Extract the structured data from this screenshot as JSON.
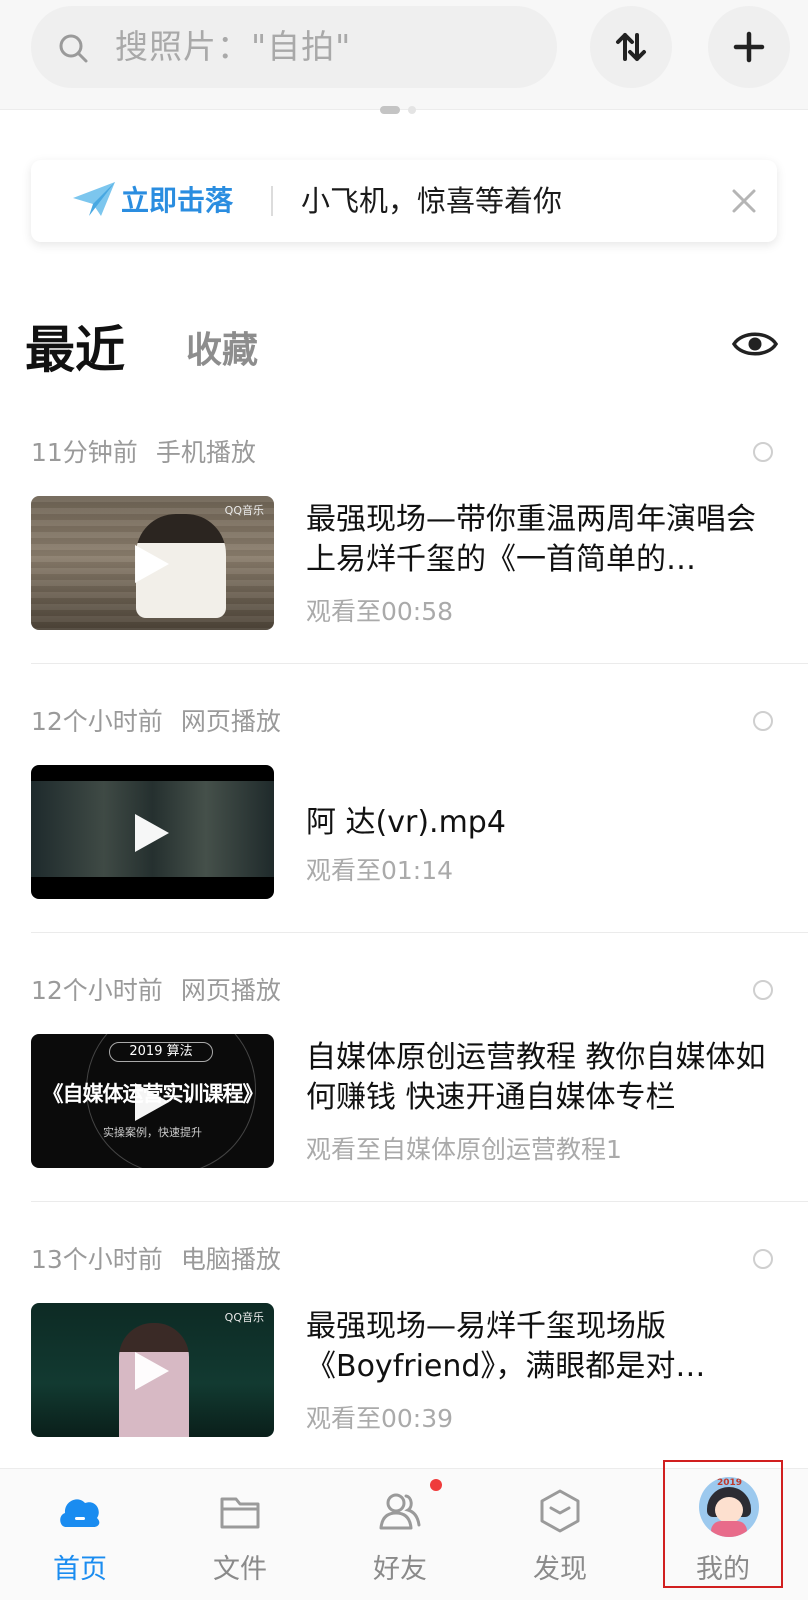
{
  "header": {
    "search_placeholder": "搜照片：\"自拍\"",
    "sort_icon": "sort-arrows-icon",
    "add_icon": "plus-icon"
  },
  "banner": {
    "action": "立即击落",
    "message": "小飞机，惊喜等着你",
    "accent_color": "#2a8de0"
  },
  "tabs": {
    "recent": "最近",
    "favorites": "收藏"
  },
  "history": [
    {
      "time": "11分钟前",
      "source": "手机播放",
      "title": "最强现场—带你重温两周年演唱会上易烊千玺的《一首简单的…",
      "progress": "观看至00:58"
    },
    {
      "time": "12个小时前",
      "source": "网页播放",
      "title": "阿 达(vr).mp4",
      "progress": "观看至01:14"
    },
    {
      "time": "12个小时前",
      "source": "网页播放",
      "title": "自媒体原创运营教程 教你自媒体如何赚钱 快速开通自媒体专栏",
      "progress": "观看至自媒体原创运营教程1",
      "thumb_year": "2019",
      "thumb_label": "算法",
      "thumb_big": "《自媒体运营实训课程》",
      "thumb_small": "实操案例，快速提升"
    },
    {
      "time": "13个小时前",
      "source": "电脑播放",
      "title": "最强现场—易烊千玺现场版《Boyfriend》，满眼都是对…",
      "progress": "观看至00:39"
    }
  ],
  "thumb_badge": "QQ音乐",
  "bottom_nav": {
    "items": [
      {
        "label": "首页",
        "icon": "cloud-home-icon",
        "active": true
      },
      {
        "label": "文件",
        "icon": "folder-icon"
      },
      {
        "label": "好友",
        "icon": "friends-icon",
        "badge": true
      },
      {
        "label": "发现",
        "icon": "discover-box-icon"
      },
      {
        "label": "我的",
        "icon": "avatar-icon"
      }
    ],
    "avatar_year": "2019",
    "active_color": "#1a8cf0",
    "badge_color": "#ef3b3b"
  }
}
